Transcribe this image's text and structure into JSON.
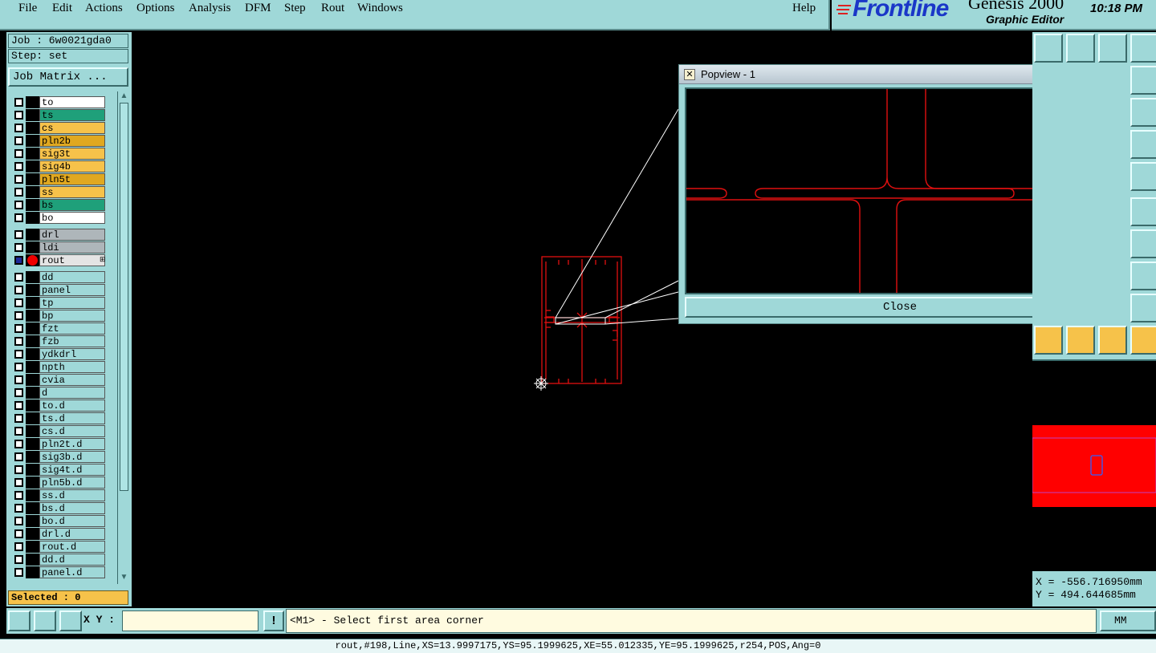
{
  "menu": [
    "File",
    "Edit",
    "Actions",
    "Options",
    "Analysis",
    "DFM",
    "Step",
    "Rout",
    "Windows"
  ],
  "help": "Help",
  "brand": {
    "logo": "Frontline",
    "product": "Genesis 2000",
    "subtitle": "Graphic Editor",
    "clock": "10:18 PM"
  },
  "job": {
    "job_label": "Job : 6w0021gda0",
    "step_label": "Step: set",
    "matrix_button": "Job Matrix ..."
  },
  "layers": [
    {
      "name": "to",
      "color": "#ffffff"
    },
    {
      "name": "ts",
      "color": "#1fa07a"
    },
    {
      "name": "cs",
      "color": "#f6c24a"
    },
    {
      "name": "pln2b",
      "color": "#e0a820"
    },
    {
      "name": "sig3t",
      "color": "#f6c24a"
    },
    {
      "name": "sig4b",
      "color": "#f6c24a"
    },
    {
      "name": "pln5t",
      "color": "#e0a820"
    },
    {
      "name": "ss",
      "color": "#f6c24a"
    },
    {
      "name": "bs",
      "color": "#1fa07a"
    },
    {
      "name": "bo",
      "color": "#ffffff"
    },
    {
      "name": "drl",
      "color": "#aeb6ba"
    },
    {
      "name": "ldi",
      "color": "#aeb6ba"
    },
    {
      "name": "rout",
      "color": "#e4e4e4",
      "active": true,
      "mark": "⊞"
    },
    {
      "name": "dd",
      "color": "#9fd8d8"
    },
    {
      "name": "panel",
      "color": "#9fd8d8"
    },
    {
      "name": "tp",
      "color": "#9fd8d8"
    },
    {
      "name": "bp",
      "color": "#9fd8d8"
    },
    {
      "name": "fzt",
      "color": "#9fd8d8"
    },
    {
      "name": "fzb",
      "color": "#9fd8d8"
    },
    {
      "name": "ydkdrl",
      "color": "#9fd8d8"
    },
    {
      "name": "npth",
      "color": "#9fd8d8"
    },
    {
      "name": "cvia",
      "color": "#9fd8d8"
    },
    {
      "name": "d",
      "color": "#9fd8d8"
    },
    {
      "name": "to.d",
      "color": "#9fd8d8"
    },
    {
      "name": "ts.d",
      "color": "#9fd8d8"
    },
    {
      "name": "cs.d",
      "color": "#9fd8d8"
    },
    {
      "name": "pln2t.d",
      "color": "#9fd8d8"
    },
    {
      "name": "sig3b.d",
      "color": "#9fd8d8"
    },
    {
      "name": "sig4t.d",
      "color": "#9fd8d8"
    },
    {
      "name": "pln5b.d",
      "color": "#9fd8d8"
    },
    {
      "name": "ss.d",
      "color": "#9fd8d8"
    },
    {
      "name": "bs.d",
      "color": "#9fd8d8"
    },
    {
      "name": "bo.d",
      "color": "#9fd8d8"
    },
    {
      "name": "drl.d",
      "color": "#9fd8d8"
    },
    {
      "name": "rout.d",
      "color": "#9fd8d8"
    },
    {
      "name": "dd.d",
      "color": "#9fd8d8"
    },
    {
      "name": "panel.d",
      "color": "#9fd8d8"
    }
  ],
  "selected": "Selected : 0",
  "popview": {
    "title": "Popview - 1",
    "close_x": "x",
    "close_button": "Close"
  },
  "coords": {
    "x": "X = -556.716950mm",
    "y": "Y =  494.644685mm"
  },
  "cmd": {
    "xy_label": "X Y :",
    "xy_value": "",
    "bang": "!",
    "prompt": "<M1> - Select first area corner",
    "units": "MM"
  },
  "status": "rout,#198,Line,XS=13.9997175,YS=95.1999625,XE=55.012335,YE=95.1999625,r254,POS,Ang=0",
  "colors": {
    "panel": "#9fd8d8",
    "feature": "#e01010",
    "overview": "#ff0000"
  }
}
